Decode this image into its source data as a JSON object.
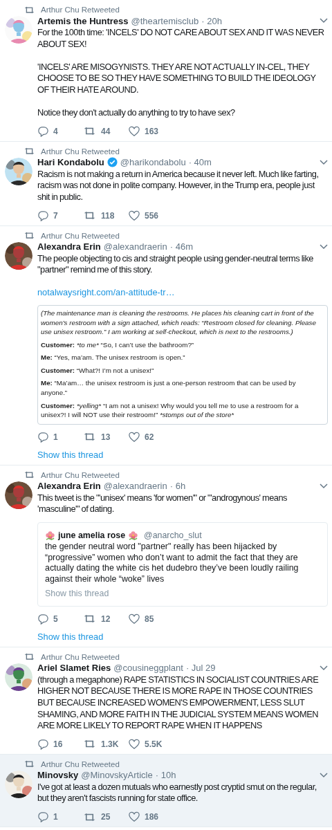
{
  "tweets": [
    {
      "retweeted_by": "Arthur Chu Retweeted",
      "name": "Artemis the Huntress",
      "verified": false,
      "handle": "@theartemisclub",
      "time": "· 20h",
      "body": "For the 100th time: 'INCELS' DO NOT CARE ABOUT SEX AND IT WAS NEVER ABOUT SEX!\n\n'INCELS' ARE MISOGYNISTS. THEY ARE NOT ACTUALLY IN-CEL, THEY CHOOSE TO BE SO THEY HAVE SOMETHING TO BUILD THE IDEOLOGY OF THEIR HATE AROUND.\n\nNotice they don't actually do anything to try to have sex?",
      "replies": "4",
      "retweets": "44",
      "likes": "163",
      "highlighted": false
    },
    {
      "retweeted_by": "Arthur Chu Retweeted",
      "name": "Hari Kondabolu",
      "verified": true,
      "handle": "@harikondabolu",
      "time": "· 40m",
      "body": "Racism is not making a return in America because it never left. Much like farting, racism was not done in polite company. However, in the Trump era, people just shit in public.",
      "replies": "7",
      "retweets": "118",
      "likes": "556",
      "highlighted": false
    },
    {
      "retweeted_by": "Arthur Chu Retweeted",
      "name": "Alexandra Erin",
      "verified": false,
      "handle": "@alexandraerin",
      "time": "· 46m",
      "body": "The people objecting to cis and straight people using gender-neutral terms like \"partner\" remind me of this story.",
      "link": "notalwaysright.com/an-attitude-tr…",
      "document": [
        {
          "kind": "narration",
          "text": "(The maintenance man is cleaning the restrooms. He places his cleaning cart in front of the women’s restroom with a sign attached, which reads: “Restroom closed for cleaning. Please use unisex restroom.” I am working at self-checkout, which is next to the restrooms.)"
        },
        {
          "kind": "dialogue",
          "speaker": "Customer:",
          "action": "*to me*",
          "text": "“So, I can’t use the bathroom?”"
        },
        {
          "kind": "dialogue",
          "speaker": "Me:",
          "text": "“Yes, ma’am. The unisex restroom is open.”"
        },
        {
          "kind": "dialogue",
          "speaker": "Customer:",
          "text": "“What?! I’m not a unisex!”"
        },
        {
          "kind": "dialogue",
          "speaker": "Me:",
          "text": "“Ma’am… the unisex restroom is just a one-person restroom that can be used by anyone.”"
        },
        {
          "kind": "dialogue",
          "speaker": "Customer:",
          "action": "*yelling*",
          "text": "“I am not a unisex! Why would you tell me to use a restroom for a unisex?! I will NOT use their restroom!”",
          "after_action": "*stomps out of the store*"
        }
      ],
      "replies": "1",
      "retweets": "13",
      "likes": "62",
      "show_thread": "Show this thread",
      "highlighted": false
    },
    {
      "retweeted_by": "Arthur Chu Retweeted",
      "name": "Alexandra Erin",
      "verified": false,
      "handle": "@alexandraerin",
      "time": "· 6h",
      "body": "This tweet is the \"'unisex' means 'for women'\" or \"'androgynous' means 'masculine'\" of dating.",
      "quote": {
        "name": "june amelia rose",
        "handle": "@anarcho_slut",
        "body": "the gender neutral word \"partner\" really has been hijacked by “progressive” women who don’t want to admit the fact that they are actually dating the white cis het dudebro they’ve been loudly railing against their whole “woke” lives",
        "show_thread": "Show this thread"
      },
      "replies": "5",
      "retweets": "12",
      "likes": "85",
      "show_thread": "Show this thread",
      "highlighted": false
    },
    {
      "retweeted_by": "Arthur Chu Retweeted",
      "name": "Ariel Slamet Ries",
      "verified": false,
      "handle": "@cousineggplant",
      "time": "· Jul 29",
      "body": "(through a megaphone) RAPE STATISTICS IN SOCIALIST COUNTRIES ARE HIGHER NOT BECAUSE THERE IS MORE RAPE IN THOSE COUNTRIES BUT BECAUSE INCREASED WOMEN'S EMPOWERMENT, LESS SLUT SHAMING, AND MORE FAITH IN THE JUDICIAL SYSTEM MEANS WOMEN ARE MORE LIKELY TO REPORT RAPE WHEN IT HAPPENS",
      "replies": "16",
      "retweets": "1.3K",
      "likes": "5.5K",
      "highlighted": false
    },
    {
      "retweeted_by": "Arthur Chu Retweeted",
      "name": "Minovsky",
      "verified": false,
      "handle": "@MinovskyArticle",
      "time": "· 10h",
      "body": "I've got at least a dozen mutuals who earnestly post cryptid smut on the regular, but they aren't fascists running for state office.",
      "replies": "1",
      "retweets": "25",
      "likes": "186",
      "highlighted": true
    }
  ]
}
